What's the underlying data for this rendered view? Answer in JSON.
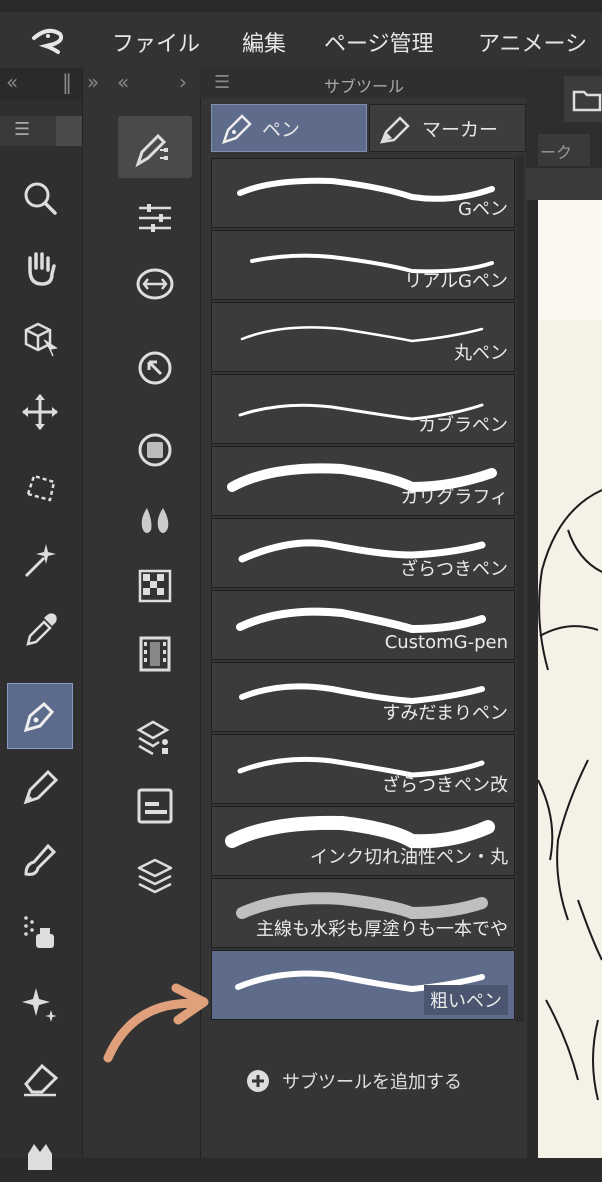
{
  "menubar": {
    "items": [
      "ファイル",
      "編集",
      "ページ管理",
      "アニメーシ"
    ]
  },
  "panel": {
    "title": "サブツール",
    "tabs": [
      {
        "label": "ペン",
        "active": true,
        "icon": "pen-nib-icon"
      },
      {
        "label": "マーカー",
        "active": false,
        "icon": "marker-icon"
      }
    ],
    "brushes": [
      {
        "label": "Gペン",
        "selected": false
      },
      {
        "label": "リアルGペン",
        "selected": false
      },
      {
        "label": "丸ペン",
        "selected": false
      },
      {
        "label": "カブラペン",
        "selected": false
      },
      {
        "label": "カリグラフィ",
        "selected": false
      },
      {
        "label": "ざらつきペン",
        "selected": false
      },
      {
        "label": "CustomG-pen",
        "selected": false
      },
      {
        "label": "すみだまりペン",
        "selected": false
      },
      {
        "label": "ざらつきペン改",
        "selected": false
      },
      {
        "label": "インク切れ油性ペン・丸",
        "selected": false
      },
      {
        "label": "主線も水彩も厚塗りも一本でや",
        "selected": false
      },
      {
        "label": "粗いペン",
        "selected": true
      }
    ],
    "add_subtool_label": "サブツールを追加する"
  },
  "canvas_tab_partial": "ーク",
  "colors": {
    "accent": "#5e6b8a",
    "arrow_annotation": "#e0a07c",
    "panel_bg": "#353535",
    "canvas": "#f6f1e6"
  },
  "tools": [
    "app-logo-icon",
    "search-icon",
    "hand-icon",
    "cube-select-icon",
    "move-icon",
    "lasso-select-icon",
    "magic-wand-icon",
    "eyedropper-icon",
    "pen-nib-icon",
    "pencil-icon",
    "brush-icon",
    "spray-icon",
    "sparkle-icon",
    "eraser-icon",
    "fill-icon"
  ]
}
